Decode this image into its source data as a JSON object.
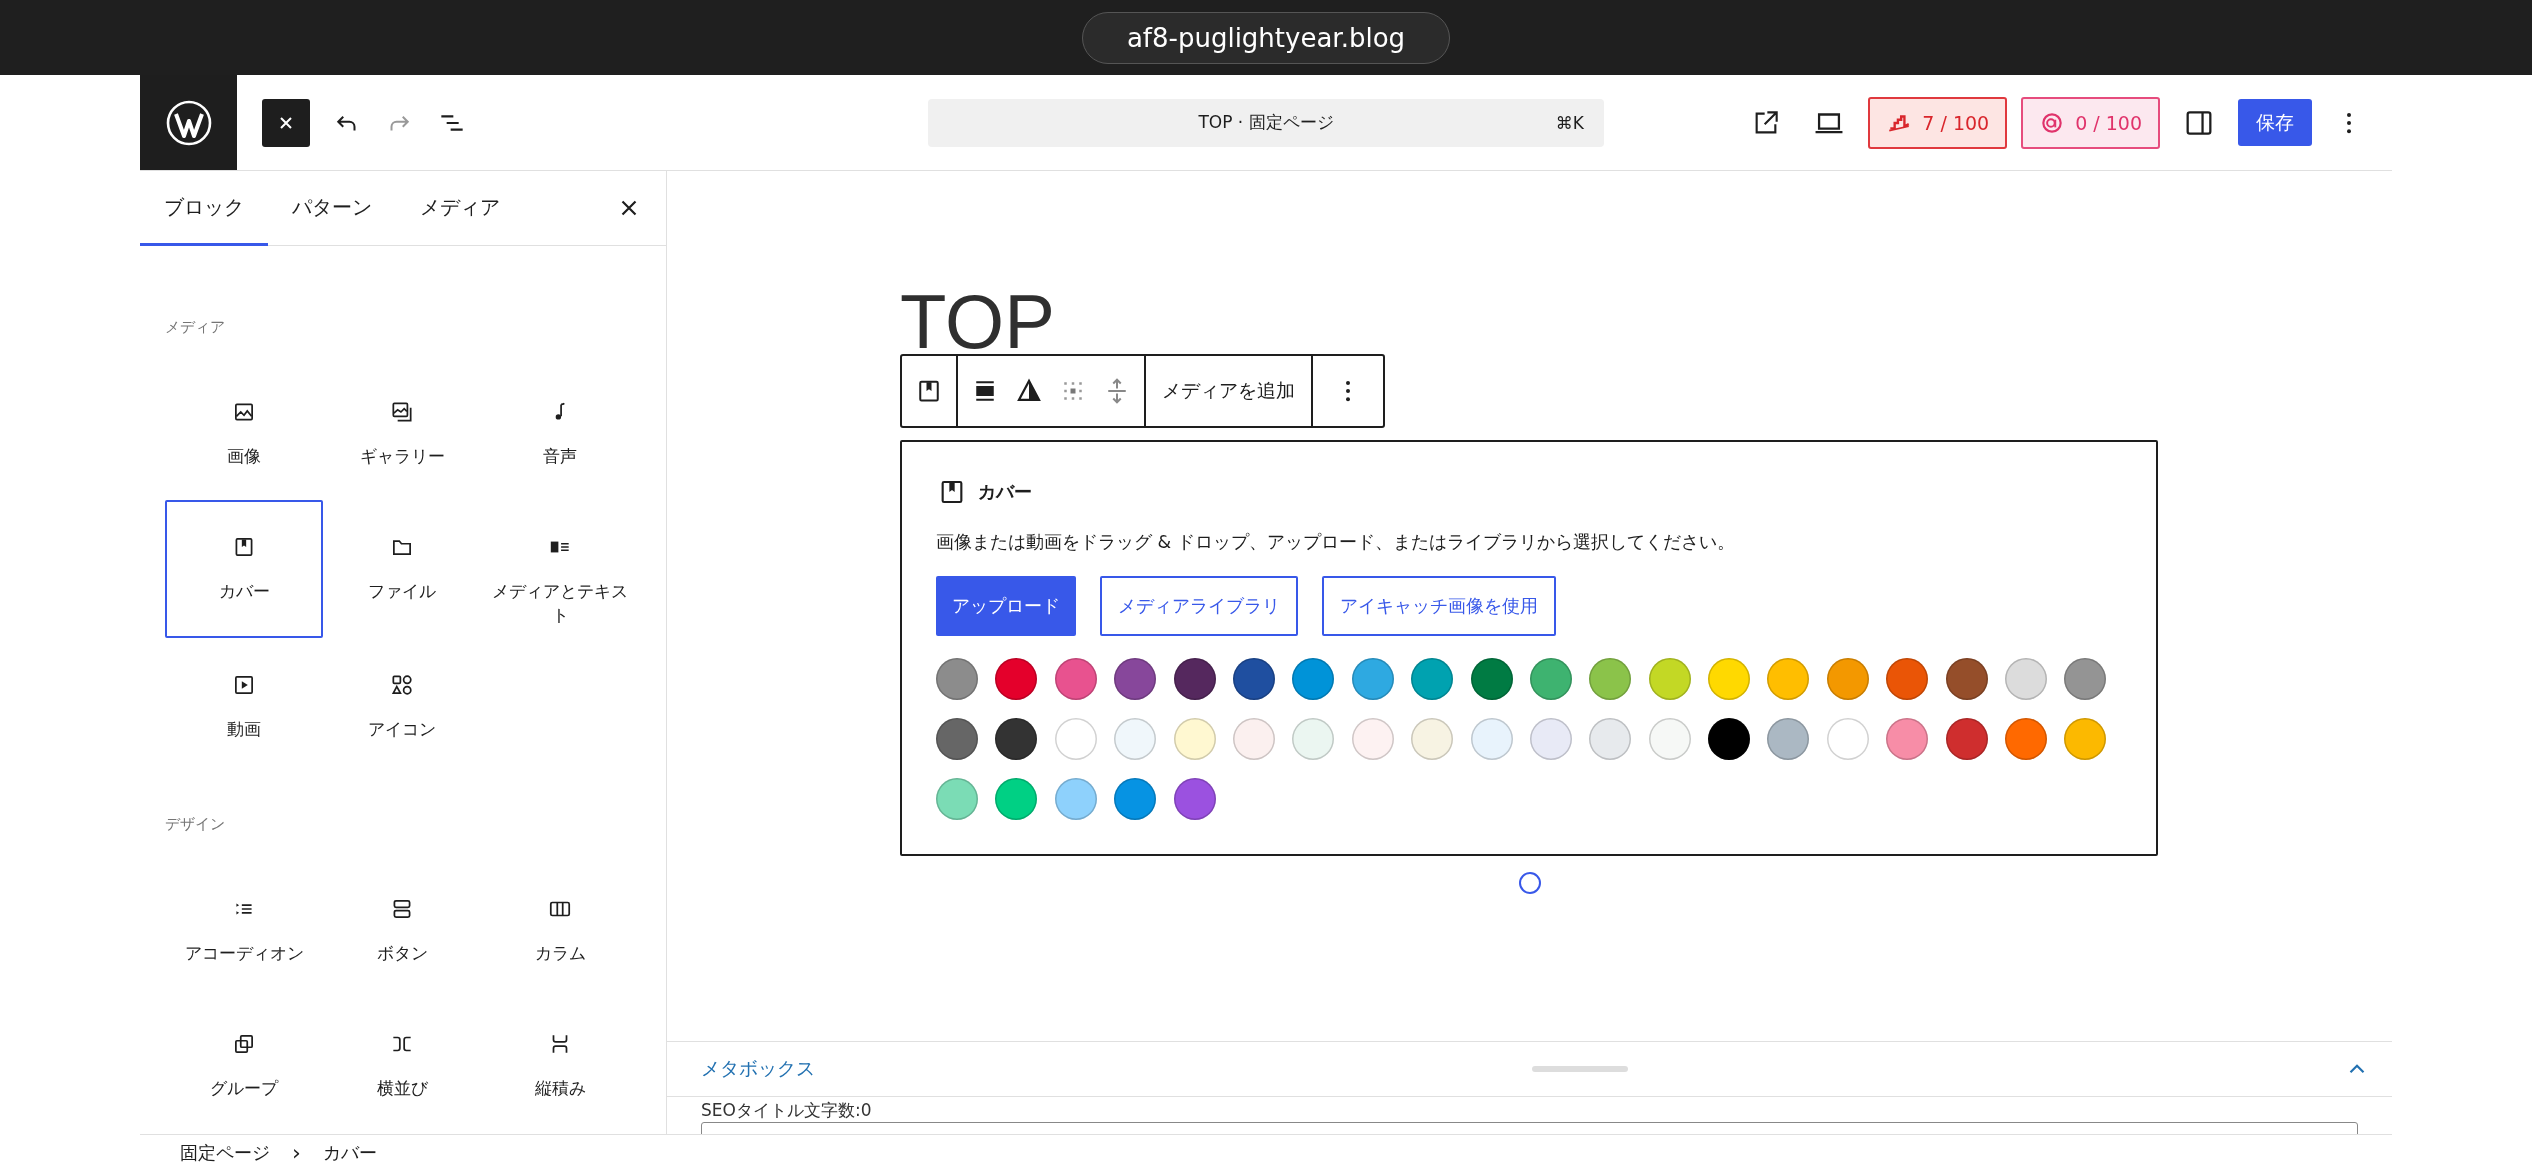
{
  "browser": {
    "url": "af8-puglightyear.blog"
  },
  "header": {
    "undo": {
      "disabled": false
    },
    "redo": {
      "disabled": true
    },
    "command_bar": {
      "title": "TOP · 固定ページ",
      "shortcut": "⌘K"
    },
    "badges": [
      {
        "kind": "seo",
        "text": "7 / 100"
      },
      {
        "kind": "ai",
        "text": "0 / 100"
      }
    ],
    "save_button": "保存"
  },
  "inserter": {
    "tabs": [
      {
        "label": "ブロック",
        "selected": true
      },
      {
        "label": "パターン",
        "selected": false
      },
      {
        "label": "メディア",
        "selected": false
      }
    ],
    "sections": [
      {
        "heading": "メディア",
        "items": [
          {
            "kind": "image",
            "label": "画像",
            "selected": false
          },
          {
            "kind": "gallery",
            "label": "ギャラリー",
            "selected": false
          },
          {
            "kind": "audio",
            "label": "音声",
            "selected": false
          },
          {
            "kind": "cover",
            "label": "カバー",
            "selected": true
          },
          {
            "kind": "file",
            "label": "ファイル",
            "selected": false
          },
          {
            "kind": "media-text",
            "label": "メディアとテキスト",
            "selected": false
          },
          {
            "kind": "video",
            "label": "動画",
            "selected": false
          },
          {
            "kind": "shapes",
            "label": "アイコン",
            "selected": false
          }
        ]
      },
      {
        "heading": "デザイン",
        "items": [
          {
            "kind": "accordion",
            "label": "アコーディオン",
            "selected": false
          },
          {
            "kind": "buttons",
            "label": "ボタン",
            "selected": false
          },
          {
            "kind": "columns",
            "label": "カラム",
            "selected": false
          },
          {
            "kind": "group",
            "label": "グループ",
            "selected": false
          },
          {
            "kind": "row",
            "label": "横並び",
            "selected": false
          },
          {
            "kind": "stack",
            "label": "縦積み",
            "selected": false
          }
        ]
      }
    ]
  },
  "editor": {
    "title": "TOP",
    "toolbar": {
      "add_media": "メディアを追加"
    },
    "cover": {
      "label": "カバー",
      "instructions": "画像または動画をドラッグ & ドロップ、アップロード、またはライブラリから選択してください。",
      "buttons": [
        {
          "kind": "primary",
          "label": "アップロード"
        },
        {
          "kind": "secondary",
          "label": "メディアライブラリ"
        },
        {
          "kind": "secondary",
          "label": "アイキャッチ画像を使用"
        }
      ],
      "swatches": [
        {
          "color": "#8c8c8c"
        },
        {
          "color": "#e4002b"
        },
        {
          "color": "#e8528f"
        },
        {
          "color": "#87479b"
        },
        {
          "color": "#55285e"
        },
        {
          "color": "#1f4fa0"
        },
        {
          "color": "#0093d8"
        },
        {
          "color": "#2ea9e1"
        },
        {
          "color": "#00a2b0"
        },
        {
          "color": "#007b43"
        },
        {
          "color": "#3eb370"
        },
        {
          "color": "#8bc34a"
        },
        {
          "color": "#c3d825"
        },
        {
          "color": "#ffd900"
        },
        {
          "color": "#ffbe00"
        },
        {
          "color": "#f39800"
        },
        {
          "color": "#ea5506"
        },
        {
          "color": "#954e2a"
        },
        {
          "color": "#dcdcdc"
        },
        {
          "color": "#949494"
        },
        {
          "color": "#666666"
        },
        {
          "color": "#333333"
        },
        {
          "color": "#ffffff"
        },
        {
          "color": "#f0f7fb"
        },
        {
          "color": "#fff8d1"
        },
        {
          "color": "#fbf0ef"
        },
        {
          "color": "#ebf6f1"
        },
        {
          "color": "#fdf2f2"
        },
        {
          "color": "#f7f3e3"
        },
        {
          "color": "#e8f3fc"
        },
        {
          "color": "#e8eaf6"
        },
        {
          "color": "#e7eaed"
        },
        {
          "color": "#f6f8f6"
        },
        {
          "color": "#000000"
        },
        {
          "color": "#abb8c3"
        },
        {
          "color": "#ffffff"
        },
        {
          "color": "#f78da7"
        },
        {
          "color": "#cf2e2e"
        },
        {
          "color": "#ff6900"
        },
        {
          "color": "#fcb900"
        },
        {
          "color": "#7bdcb5"
        },
        {
          "color": "#00d084"
        },
        {
          "color": "#8ed1fc"
        },
        {
          "color": "#0693e3"
        },
        {
          "color": "#9b51e0"
        }
      ]
    }
  },
  "metabox": {
    "title": "メタボックス",
    "expanded": true,
    "field_label": "SEOタイトル文字数:0"
  },
  "breadcrumb": {
    "items": [
      "固定ページ",
      "カバー"
    ],
    "separator": "›"
  }
}
